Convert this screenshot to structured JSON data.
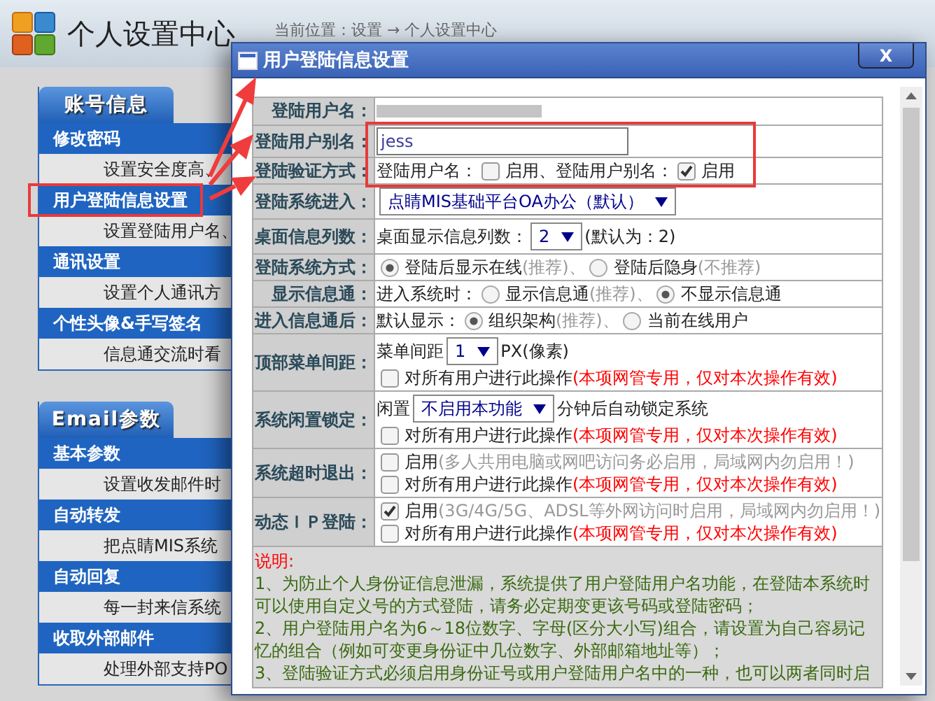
{
  "header": {
    "title": "个人设置中心",
    "breadcrumb": "当前位置：设置 → 个人设置中心"
  },
  "sidebar": {
    "sections": [
      {
        "title": "账号信息",
        "items": [
          {
            "label": "修改密码",
            "description": "设置安全度高、"
          },
          {
            "label": "用户登陆信息设置",
            "description": "设置登陆用户名、"
          },
          {
            "label": "通讯设置",
            "description": "设置个人通讯方"
          },
          {
            "label": "个性头像&手写签名",
            "description": "信息通交流时看"
          }
        ]
      },
      {
        "title": "Email参数",
        "items": [
          {
            "label": "基本参数",
            "description": "设置收发邮件时"
          },
          {
            "label": "自动转发",
            "description": "把点睛MIS系统"
          },
          {
            "label": "自动回复",
            "description": "每一封来信系统"
          },
          {
            "label": "收取外部邮件",
            "description": "处理外部支持PO"
          }
        ]
      }
    ]
  },
  "dialog": {
    "title": "用户登陆信息设置",
    "close": "X",
    "rows": [
      {
        "label": "登陆用户名：",
        "lines": [
          [
            {
              "kind": "redacted"
            }
          ]
        ]
      },
      {
        "label": "登陆用户别名：",
        "lines": [
          [
            {
              "kind": "input",
              "value": "jess"
            }
          ]
        ]
      },
      {
        "label": "登陆验证方式：",
        "lines": [
          [
            {
              "kind": "text",
              "text": "登陆用户名："
            },
            {
              "kind": "checkbox",
              "checked": false
            },
            {
              "kind": "text",
              "text": "启用、"
            },
            {
              "kind": "text",
              "text": "登陆用户别名："
            },
            {
              "kind": "checkbox",
              "checked": true
            },
            {
              "kind": "text",
              "text": "启用"
            }
          ]
        ]
      },
      {
        "label": "登陆系统进入：",
        "lines": [
          [
            {
              "kind": "select",
              "value": "点睛MIS基础平台OA办公（默认）"
            }
          ]
        ]
      },
      {
        "label": "桌面信息列数：",
        "lines": [
          [
            {
              "kind": "text",
              "text": "桌面显示信息列数："
            },
            {
              "kind": "select",
              "value": "2"
            },
            {
              "kind": "text",
              "text": "(默认为：2)"
            }
          ]
        ]
      },
      {
        "label": "登陆系统方式：",
        "lines": [
          [
            {
              "kind": "radio",
              "selected": true
            },
            {
              "kind": "text",
              "text": "登陆后显示在线"
            },
            {
              "kind": "hint",
              "text": "(推荐)、"
            },
            {
              "kind": "radio",
              "selected": false
            },
            {
              "kind": "text",
              "text": "登陆后隐身"
            },
            {
              "kind": "hint",
              "text": "(不推荐)"
            }
          ]
        ]
      },
      {
        "label": "显示信息通：",
        "lines": [
          [
            {
              "kind": "text",
              "text": "进入系统时："
            },
            {
              "kind": "radio",
              "selected": false
            },
            {
              "kind": "text",
              "text": "显示信息通"
            },
            {
              "kind": "hint",
              "text": "(推荐)、"
            },
            {
              "kind": "radio",
              "selected": true
            },
            {
              "kind": "text",
              "text": "不显示信息通"
            }
          ]
        ]
      },
      {
        "label": "进入信息通后：",
        "lines": [
          [
            {
              "kind": "text",
              "text": "默认显示："
            },
            {
              "kind": "radio",
              "selected": true
            },
            {
              "kind": "text",
              "text": "组织架构"
            },
            {
              "kind": "hint",
              "text": "(推荐)、"
            },
            {
              "kind": "radio",
              "selected": false
            },
            {
              "kind": "text",
              "text": "当前在线用户"
            }
          ]
        ]
      },
      {
        "label": "顶部菜单间距：",
        "lines": [
          [
            {
              "kind": "text",
              "text": "菜单间距"
            },
            {
              "kind": "select",
              "value": "1"
            },
            {
              "kind": "text",
              "text": "PX(像素)"
            }
          ],
          [
            {
              "kind": "checkbox",
              "checked": false
            },
            {
              "kind": "text",
              "text": "对所有用户进行此操作"
            },
            {
              "kind": "warning",
              "text": "(本项网管专用，仅对本次操作有效)"
            }
          ]
        ]
      },
      {
        "label": "系统闲置锁定：",
        "lines": [
          [
            {
              "kind": "text",
              "text": "闲置"
            },
            {
              "kind": "select",
              "value": "不启用本功能"
            },
            {
              "kind": "text",
              "text": "分钟后自动锁定系统"
            }
          ],
          [
            {
              "kind": "checkbox",
              "checked": false
            },
            {
              "kind": "text",
              "text": "对所有用户进行此操作"
            },
            {
              "kind": "warning",
              "text": "(本项网管专用，仅对本次操作有效)"
            }
          ]
        ]
      },
      {
        "label": "系统超时退出：",
        "lines": [
          [
            {
              "kind": "checkbox",
              "checked": false
            },
            {
              "kind": "text",
              "text": "启用"
            },
            {
              "kind": "hint",
              "text": "(多人共用电脑或网吧访问务必启用，局域网内勿启用！)"
            }
          ],
          [
            {
              "kind": "checkbox",
              "checked": false
            },
            {
              "kind": "text",
              "text": "对所有用户进行此操作"
            },
            {
              "kind": "warning",
              "text": "(本项网管专用，仅对本次操作有效)"
            }
          ]
        ]
      },
      {
        "label": "动态ＩＰ登陆：",
        "lines": [
          [
            {
              "kind": "checkbox",
              "checked": true
            },
            {
              "kind": "text",
              "text": "启用"
            },
            {
              "kind": "hint",
              "text": "(3G/4G/5G、ADSL等外网访问时启用，局域网内勿启用！)"
            }
          ],
          [
            {
              "kind": "checkbox",
              "checked": false
            },
            {
              "kind": "text",
              "text": "对所有用户进行此操作"
            },
            {
              "kind": "warning",
              "text": "(本项网管专用，仅对本次操作有效)"
            }
          ]
        ]
      }
    ],
    "notes": {
      "title": "说明:",
      "paragraphs": [
        "1、为防止个人身份证信息泄漏，系统提供了用户登陆用户名功能，在登陆本系统时可以使用自定义号的方式登陆，请务必定期变更该号码或登陆密码；",
        "2、用户登陆用户名为6～18位数字、字母(区分大小写)组合，请设置为自己容易记忆的组合（例如可变更身份证中几位数字、外部邮箱地址等）；",
        "3、登陆验证方式必须启用身份证号或用户登陆用户名中的一种，也可以两者同时启"
      ]
    }
  }
}
